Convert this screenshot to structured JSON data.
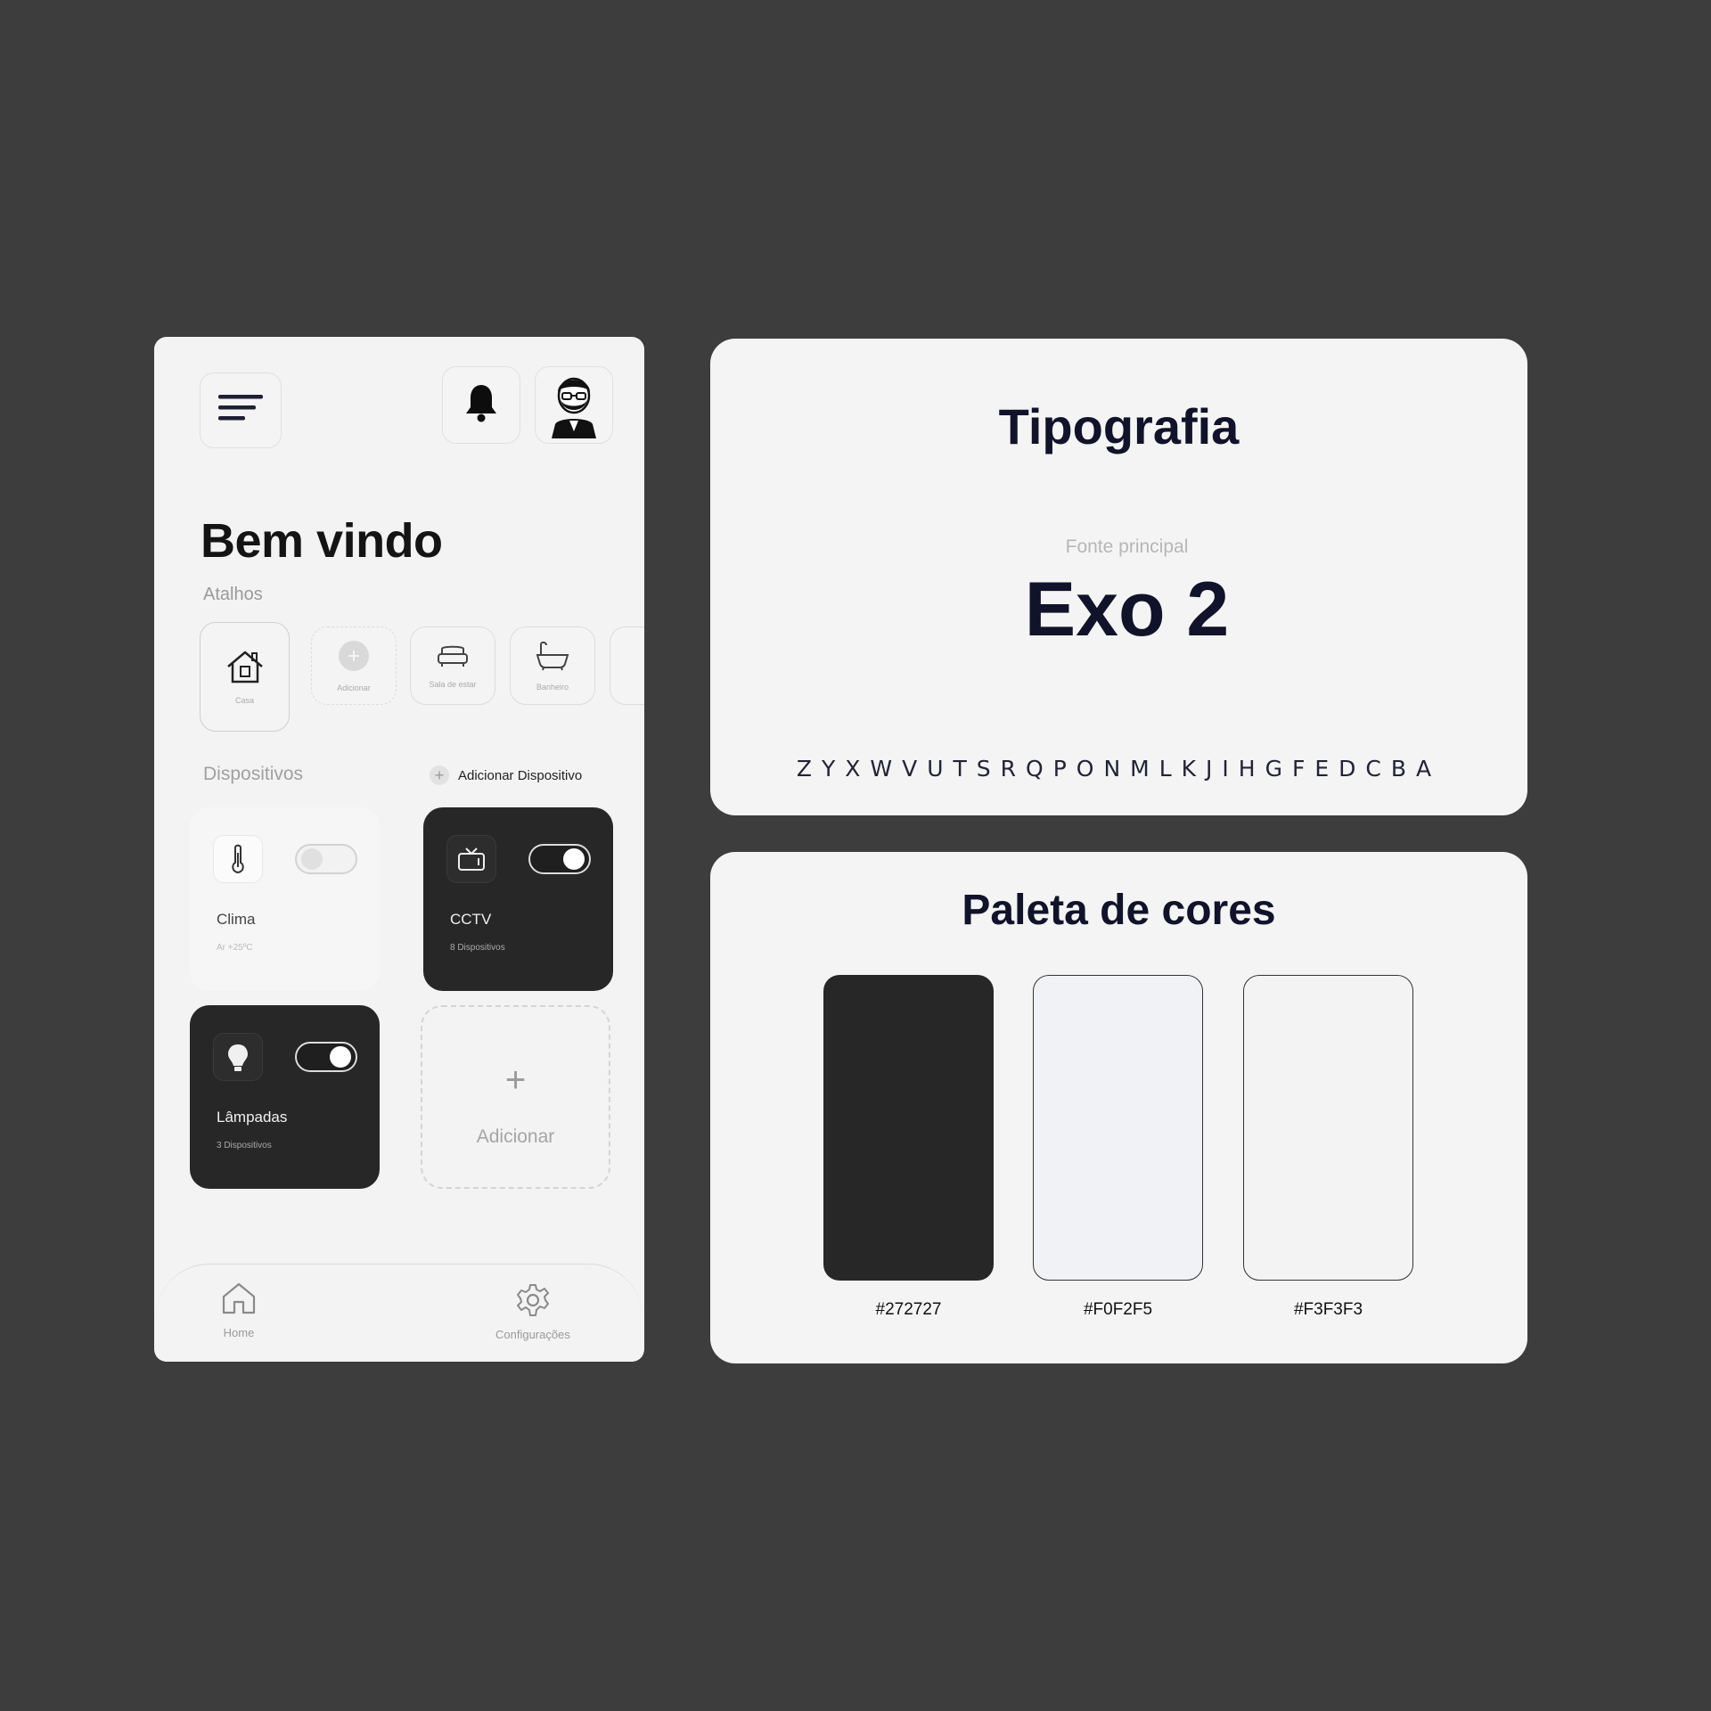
{
  "phone": {
    "welcome": "Bem vindo",
    "shortcuts_title": "Atalhos",
    "shortcuts": [
      {
        "label": "Casa",
        "icon": "house-icon"
      },
      {
        "label": "Adicionar",
        "icon": "plus-icon"
      },
      {
        "label": "Sala de estar",
        "icon": "sofa-icon"
      },
      {
        "label": "Banheiro",
        "icon": "bathtub-icon"
      }
    ],
    "devices_title": "Dispositivos",
    "add_device_label": "Adicionar Dispositivo",
    "devices": [
      {
        "name": "Clima",
        "sub": "Ar +25ºC",
        "icon": "thermometer-icon",
        "on": false,
        "theme": "light"
      },
      {
        "name": "CCTV",
        "sub": "8 Dispositivos",
        "icon": "tv-icon",
        "on": true,
        "theme": "dark"
      },
      {
        "name": "Lâmpadas",
        "sub": "3 Dispositivos",
        "icon": "lightbulb-icon",
        "on": true,
        "theme": "dark"
      }
    ],
    "add_card": {
      "plus": "+",
      "label": "Adicionar"
    },
    "nav": [
      {
        "label": "Home",
        "icon": "home-icon"
      },
      {
        "label": "Configurações",
        "icon": "gear-icon"
      }
    ]
  },
  "typography": {
    "title": "Tipografia",
    "subtitle": "Fonte principal",
    "font_name": "Exo 2",
    "alphabet": "ZYXWVUTSRQPONMLKJIHGFEDCBA"
  },
  "palette": {
    "title": "Paleta de cores",
    "colors": [
      {
        "hex": "#272727",
        "label": "#272727"
      },
      {
        "hex": "#F0F2F5",
        "label": "#F0F2F5"
      },
      {
        "hex": "#F3F3F3",
        "label": "#F3F3F3"
      }
    ]
  }
}
